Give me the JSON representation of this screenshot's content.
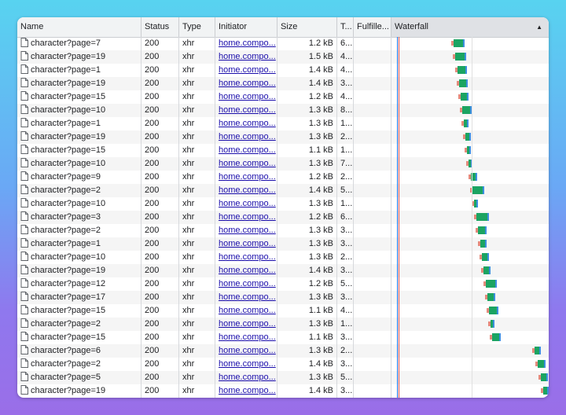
{
  "columns": {
    "name": "Name",
    "status": "Status",
    "type": "Type",
    "initiator": "Initiator",
    "size": "Size",
    "time": "T...",
    "fulfilled": "Fulfille...",
    "waterfall": "Waterfall"
  },
  "sort_icon": "sort-ascending-icon",
  "colors": {
    "accent_red": "#d9534f",
    "accent_blue": "#1a73e8",
    "bar_green": "#1ba462",
    "bar_wait": "#e38b7c",
    "link": "#1a0dab"
  },
  "rows": [
    {
      "name": "character?page=7",
      "status": "200",
      "type": "xhr",
      "initiator": "home.compo...",
      "size": "1.2 kB",
      "time": "6..."
    },
    {
      "name": "character?page=19",
      "status": "200",
      "type": "xhr",
      "initiator": "home.compo...",
      "size": "1.5 kB",
      "time": "4..."
    },
    {
      "name": "character?page=1",
      "status": "200",
      "type": "xhr",
      "initiator": "home.compo...",
      "size": "1.4 kB",
      "time": "4..."
    },
    {
      "name": "character?page=19",
      "status": "200",
      "type": "xhr",
      "initiator": "home.compo...",
      "size": "1.4 kB",
      "time": "3..."
    },
    {
      "name": "character?page=15",
      "status": "200",
      "type": "xhr",
      "initiator": "home.compo...",
      "size": "1.2 kB",
      "time": "4..."
    },
    {
      "name": "character?page=10",
      "status": "200",
      "type": "xhr",
      "initiator": "home.compo...",
      "size": "1.3 kB",
      "time": "8..."
    },
    {
      "name": "character?page=1",
      "status": "200",
      "type": "xhr",
      "initiator": "home.compo...",
      "size": "1.3 kB",
      "time": "1..."
    },
    {
      "name": "character?page=19",
      "status": "200",
      "type": "xhr",
      "initiator": "home.compo...",
      "size": "1.3 kB",
      "time": "2..."
    },
    {
      "name": "character?page=15",
      "status": "200",
      "type": "xhr",
      "initiator": "home.compo...",
      "size": "1.1 kB",
      "time": "1..."
    },
    {
      "name": "character?page=10",
      "status": "200",
      "type": "xhr",
      "initiator": "home.compo...",
      "size": "1.3 kB",
      "time": "7..."
    },
    {
      "name": "character?page=9",
      "status": "200",
      "type": "xhr",
      "initiator": "home.compo...",
      "size": "1.2 kB",
      "time": "2..."
    },
    {
      "name": "character?page=2",
      "status": "200",
      "type": "xhr",
      "initiator": "home.compo...",
      "size": "1.4 kB",
      "time": "5..."
    },
    {
      "name": "character?page=10",
      "status": "200",
      "type": "xhr",
      "initiator": "home.compo...",
      "size": "1.3 kB",
      "time": "1..."
    },
    {
      "name": "character?page=3",
      "status": "200",
      "type": "xhr",
      "initiator": "home.compo...",
      "size": "1.2 kB",
      "time": "6..."
    },
    {
      "name": "character?page=2",
      "status": "200",
      "type": "xhr",
      "initiator": "home.compo...",
      "size": "1.3 kB",
      "time": "3..."
    },
    {
      "name": "character?page=1",
      "status": "200",
      "type": "xhr",
      "initiator": "home.compo...",
      "size": "1.3 kB",
      "time": "3..."
    },
    {
      "name": "character?page=10",
      "status": "200",
      "type": "xhr",
      "initiator": "home.compo...",
      "size": "1.3 kB",
      "time": "2..."
    },
    {
      "name": "character?page=19",
      "status": "200",
      "type": "xhr",
      "initiator": "home.compo...",
      "size": "1.4 kB",
      "time": "3..."
    },
    {
      "name": "character?page=12",
      "status": "200",
      "type": "xhr",
      "initiator": "home.compo...",
      "size": "1.2 kB",
      "time": "5..."
    },
    {
      "name": "character?page=17",
      "status": "200",
      "type": "xhr",
      "initiator": "home.compo...",
      "size": "1.3 kB",
      "time": "3..."
    },
    {
      "name": "character?page=15",
      "status": "200",
      "type": "xhr",
      "initiator": "home.compo...",
      "size": "1.1 kB",
      "time": "4..."
    },
    {
      "name": "character?page=2",
      "status": "200",
      "type": "xhr",
      "initiator": "home.compo...",
      "size": "1.3 kB",
      "time": "1..."
    },
    {
      "name": "character?page=15",
      "status": "200",
      "type": "xhr",
      "initiator": "home.compo...",
      "size": "1.1 kB",
      "time": "3..."
    },
    {
      "name": "character?page=6",
      "status": "200",
      "type": "xhr",
      "initiator": "home.compo...",
      "size": "1.3 kB",
      "time": "2..."
    },
    {
      "name": "character?page=2",
      "status": "200",
      "type": "xhr",
      "initiator": "home.compo...",
      "size": "1.4 kB",
      "time": "3..."
    },
    {
      "name": "character?page=5",
      "status": "200",
      "type": "xhr",
      "initiator": "home.compo...",
      "size": "1.3 kB",
      "time": "5..."
    },
    {
      "name": "character?page=19",
      "status": "200",
      "type": "xhr",
      "initiator": "home.compo...",
      "size": "1.4 kB",
      "time": "3..."
    }
  ]
}
